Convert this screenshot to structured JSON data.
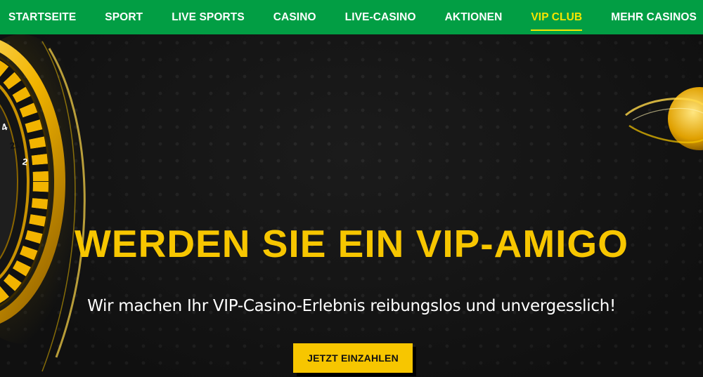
{
  "nav": {
    "items": [
      {
        "label": "STARTSEITE",
        "active": false
      },
      {
        "label": "SPORT",
        "active": false
      },
      {
        "label": "LIVE SPORTS",
        "active": false
      },
      {
        "label": "CASINO",
        "active": false
      },
      {
        "label": "LIVE-CASINO",
        "active": false
      },
      {
        "label": "AKTIONEN",
        "active": false
      },
      {
        "label": "VIP CLUB",
        "active": true
      },
      {
        "label": "MEHR CASINOS",
        "active": false
      }
    ]
  },
  "hero": {
    "title": "WERDEN SIE EIN VIP-AMIGO",
    "subtitle": "Wir machen Ihr VIP-Casino-Erlebnis reibungslos und unvergesslich!",
    "cta_label": "JETZT EINZAHLEN",
    "roulette_numbers": [
      "4",
      "21",
      "2"
    ]
  },
  "colors": {
    "nav_bg": "#029e44",
    "nav_active": "#f6e500",
    "accent_gold": "#f7c600",
    "hero_bg": "#191919"
  }
}
